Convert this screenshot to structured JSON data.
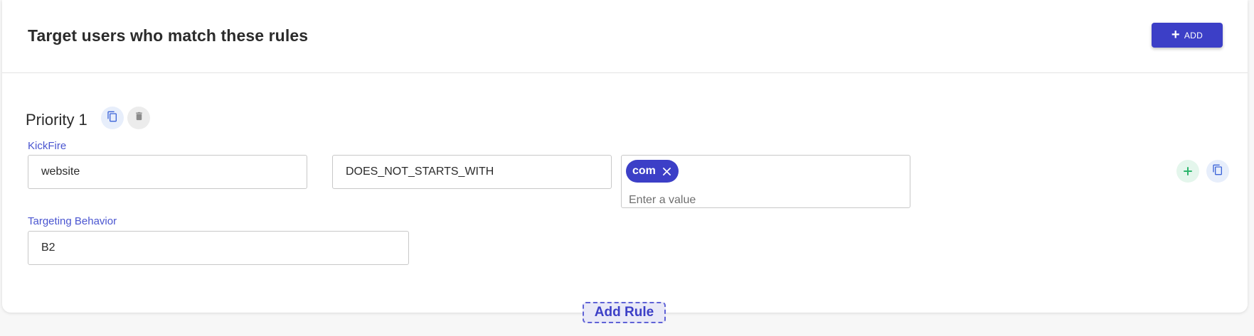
{
  "header": {
    "title": "Target users who match these rules",
    "add_button_label": "ADD"
  },
  "priority": {
    "title": "Priority 1"
  },
  "rule": {
    "source_label": "KickFire",
    "attribute_value": "website",
    "operator_value": "DOES_NOT_STARTS_WITH",
    "chips": [
      "com"
    ],
    "value_placeholder": "Enter a value"
  },
  "targeting": {
    "label": "Targeting Behavior",
    "value": "B2"
  },
  "footer": {
    "add_rule_label": "Add Rule"
  },
  "icons": {
    "add": "plus-icon",
    "copy": "copy-icon",
    "delete": "trash-icon",
    "chip_remove": "close-icon"
  },
  "colors": {
    "accent": "#3c3fc7",
    "label": "#4a55d0",
    "success": "#2bb56b"
  }
}
